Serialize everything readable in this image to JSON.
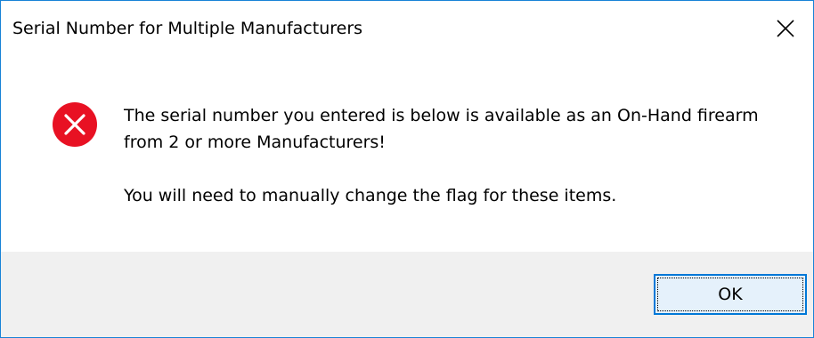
{
  "dialog": {
    "title": "Serial Number for Multiple Manufacturers",
    "close_icon": "close-icon",
    "icon": "error-icon",
    "message_line1": "The serial number you entered is below is available as an On-Hand firearm from 2 or more Manufacturers!",
    "message_line2": "You will need to manually change the flag for these items.",
    "ok_label": "OK"
  },
  "colors": {
    "border": "#1883d7",
    "error_red": "#e81123",
    "footer_bg": "#f0f0f0",
    "button_bg": "#e5f1fb",
    "button_border": "#0078d7"
  }
}
